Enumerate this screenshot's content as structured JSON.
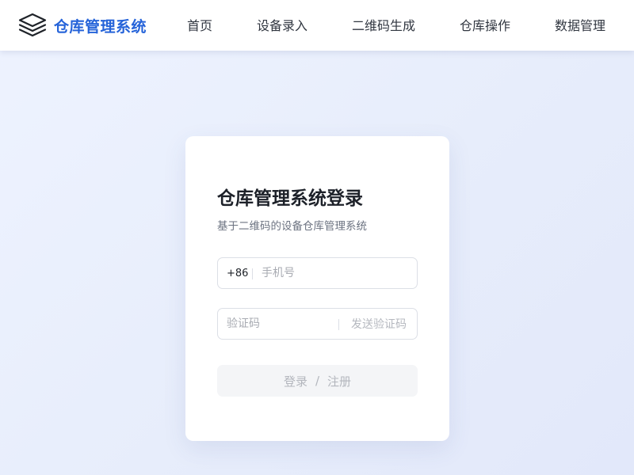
{
  "header": {
    "brand_icon": "layers-icon",
    "brand_name": "仓库管理系统",
    "brand_color": "#2563d9",
    "nav": [
      {
        "label": "首页"
      },
      {
        "label": "设备录入"
      },
      {
        "label": "二维码生成"
      },
      {
        "label": "仓库操作"
      },
      {
        "label": "数据管理"
      }
    ]
  },
  "login": {
    "title": "仓库管理系统登录",
    "subtitle": "基于二维码的设备仓库管理系统",
    "phone": {
      "prefix": "+86",
      "placeholder": "手机号",
      "value": ""
    },
    "code": {
      "placeholder": "验证码",
      "value": "",
      "send_label": "发送验证码"
    },
    "submit": {
      "login_label": "登录",
      "separator": "/",
      "register_label": "注册",
      "disabled": true
    }
  }
}
